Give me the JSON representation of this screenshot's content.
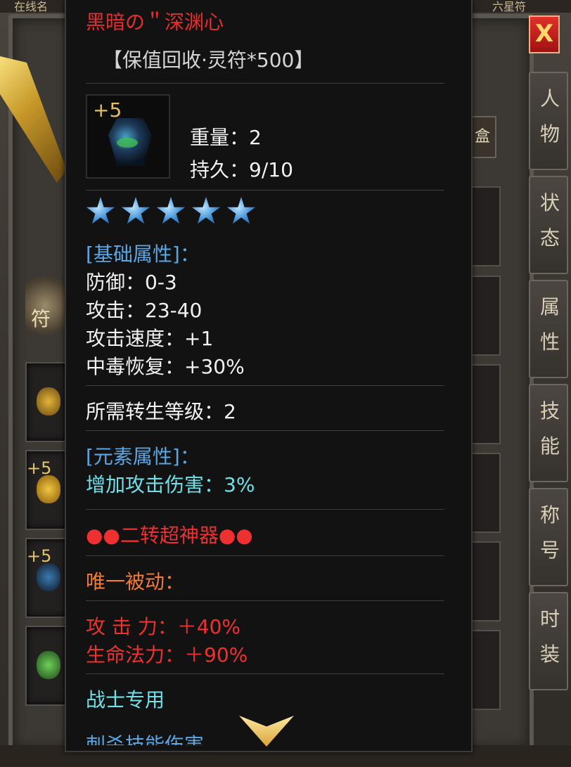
{
  "background": {
    "top_left_text": "在线名",
    "top_right_text": "六星符",
    "emblem_text": "符",
    "box_button_label": "盒",
    "slot_plus_labels": [
      "+5",
      "+5"
    ]
  },
  "close_button_label": "X",
  "side_tabs": [
    {
      "label": "人\n物"
    },
    {
      "label": "状\n态"
    },
    {
      "label": "属\n性"
    },
    {
      "label": "技\n能"
    },
    {
      "label": "称\n号"
    },
    {
      "label": "时\n装"
    }
  ],
  "tooltip": {
    "title": "黑暗の＂深渊心",
    "subtitle": "【保值回收·灵符*500】",
    "item_plus": "+5",
    "weight": "重量：2",
    "durability": "持久：9/10",
    "star_count": 5,
    "basic_header": "[基础属性]：",
    "basic_stats": [
      "防御：0-3",
      "攻击：23-40",
      "攻击速度：+1",
      "中毒恢复：+30%"
    ],
    "rebirth_level": "所需转生等级：2",
    "element_header": "[元素属性]：",
    "element_stats": [
      "增加攻击伤害：3%"
    ],
    "artifact_line": "●●二转超神器●●",
    "passive_header": "唯一被动：",
    "passive_stats": [
      "攻 击 力：＋40%",
      "生命法力：＋90%"
    ],
    "class_restriction": "战士专用",
    "cut_off_line": "刺杀技能伤害"
  },
  "colors": {
    "title_red": "#e62d2d",
    "blue_header": "#5aa7e6",
    "cyan_text": "#6fe0e8",
    "orange_text": "#ef7b3c",
    "star_blue": "#3e8ed6"
  }
}
